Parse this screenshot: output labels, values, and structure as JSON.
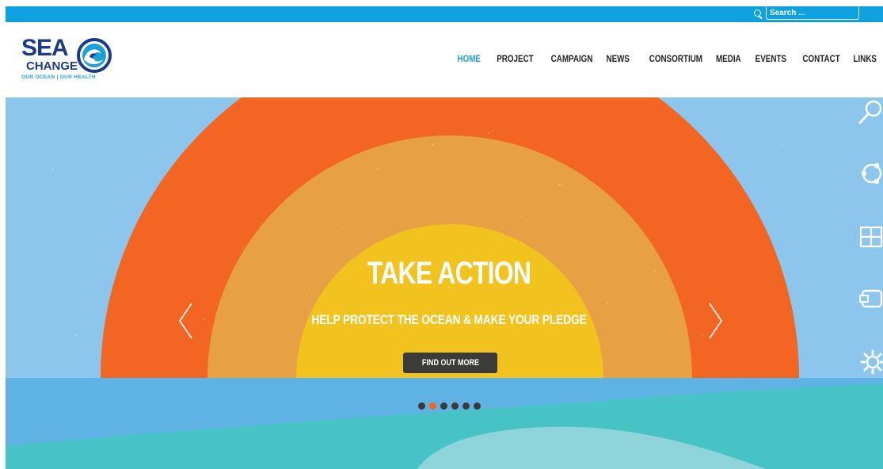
{
  "search": {
    "placeholder": "Search ..."
  },
  "logo": {
    "line1": "SEA",
    "line2": "CHANGE",
    "tagline": "OUR OCEAN | OUR HEALTH"
  },
  "nav": {
    "items": [
      {
        "label": "HOME",
        "active": true
      },
      {
        "label": "PROJECT",
        "active": false
      },
      {
        "label": "CAMPAIGN",
        "active": false
      },
      {
        "label": "NEWS",
        "active": false
      },
      {
        "label": "CONSORTIUM",
        "active": false
      },
      {
        "label": "MEDIA",
        "active": false
      },
      {
        "label": "EVENTS",
        "active": false
      },
      {
        "label": "CONTACT",
        "active": false
      },
      {
        "label": "LINKS",
        "active": false
      }
    ]
  },
  "hero": {
    "title": "TAKE ACTION",
    "subtitle": "HELP PROTECT THE OCEAN & MAKE YOUR PLEDGE",
    "cta_label": "FIND OUT MORE",
    "slide_count": 6,
    "active_slide": 2
  },
  "side_icons": [
    "search-icon",
    "share-icon",
    "windows-icon",
    "device-icon",
    "gear-icon"
  ],
  "colors": {
    "topbar": "#0fa0e0",
    "nav_active": "#1e9fd6",
    "logo_navy": "#1b3a8a",
    "sky": "#8cc6ec",
    "rainbow_outer": "#f26522",
    "rainbow_middle": "#e8a045",
    "rainbow_inner": "#f2c21e",
    "sea_top": "#5fb3e4",
    "sea_teal": "#47c3c6",
    "sea_light": "#8fd4da",
    "button": "#3d3b3a",
    "dot_active": "#f26522"
  }
}
